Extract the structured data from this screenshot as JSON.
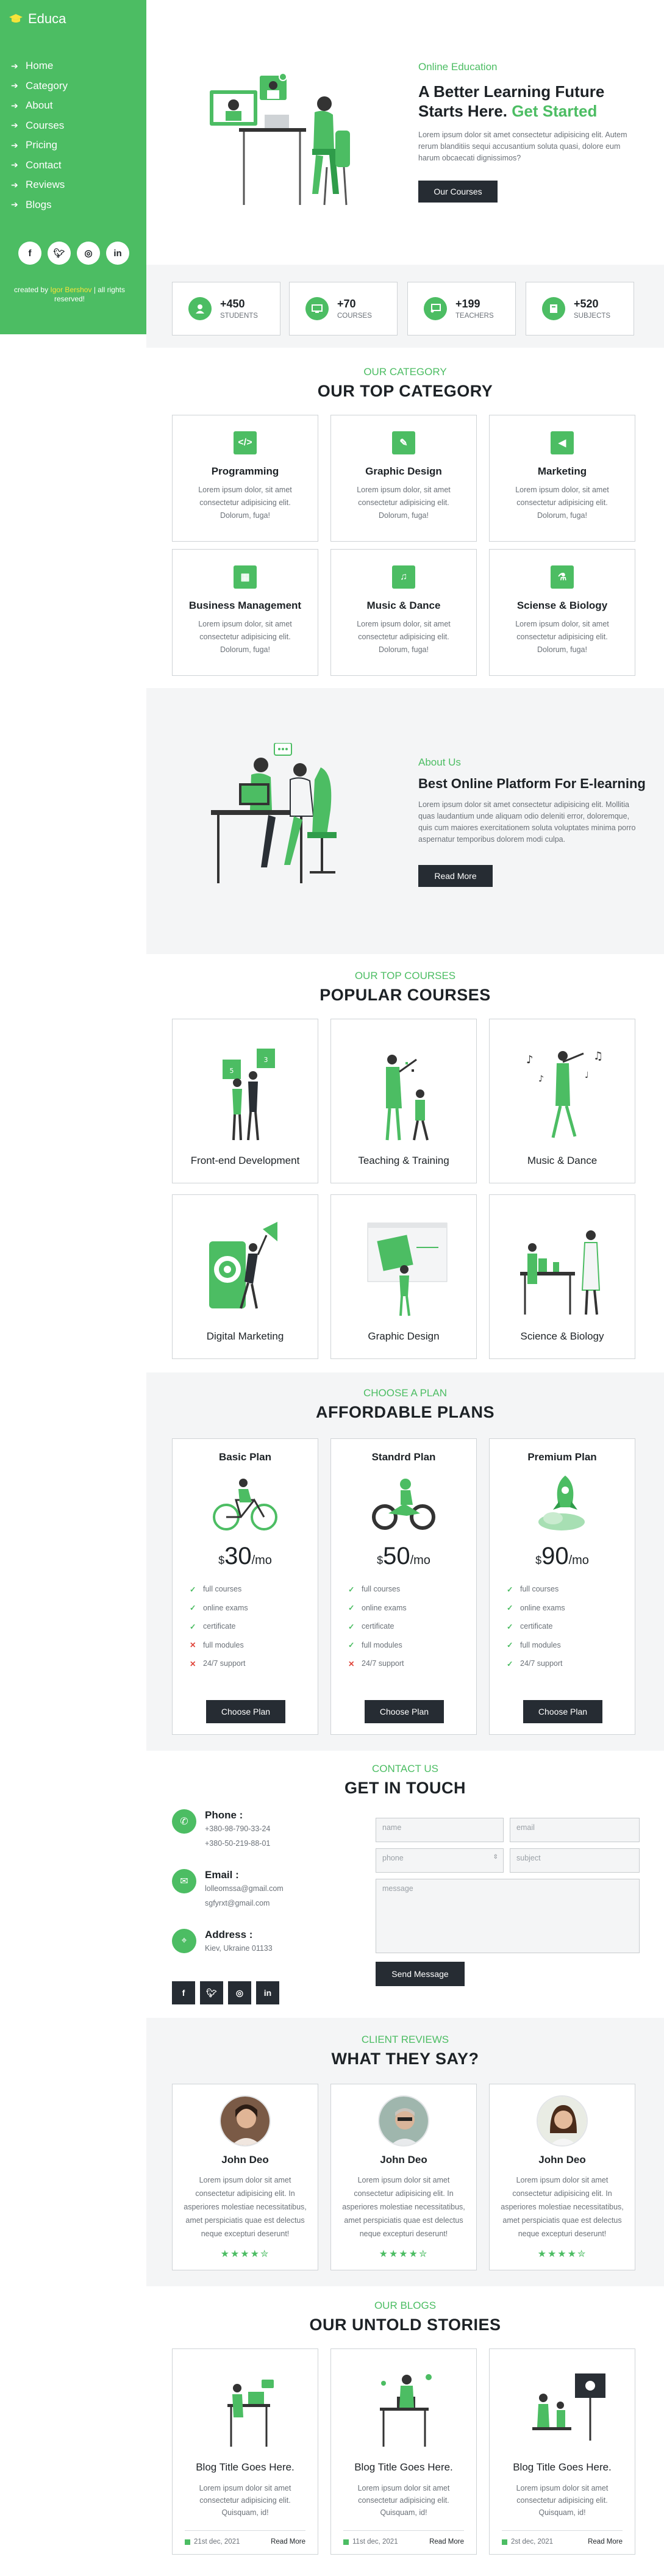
{
  "brand": {
    "name": "Educa",
    "accent": "#4cbd63",
    "dark": "#262c33"
  },
  "nav": [
    {
      "label": "Home"
    },
    {
      "label": "Category"
    },
    {
      "label": "About"
    },
    {
      "label": "Courses"
    },
    {
      "label": "Pricing"
    },
    {
      "label": "Contact"
    },
    {
      "label": "Reviews"
    },
    {
      "label": "Blogs"
    }
  ],
  "sidebar_socials": [
    "facebook-icon",
    "twitter-icon",
    "instagram-icon",
    "linkedin-icon"
  ],
  "credit": {
    "prefix": "created by",
    "author": "Igor Bershov",
    "suffix": "| all rights reserved!"
  },
  "hero": {
    "kicker": "Online Education",
    "title_a": "A Better Learning Future Starts Here.",
    "title_b": "Get Started",
    "text": "Lorem ipsum dolor sit amet consectetur adipisicing elit. Autem rerum blanditiis sequi accusantium soluta quasi, dolore eum harum obcaecati dignissimos?",
    "button": "Our Courses"
  },
  "stats": [
    {
      "num": "+450",
      "label": "STUDENTS",
      "icon": "graduate-icon"
    },
    {
      "num": "+70",
      "label": "COURSES",
      "icon": "monitor-icon"
    },
    {
      "num": "+199",
      "label": "TEACHERS",
      "icon": "chalkboard-icon"
    },
    {
      "num": "+520",
      "label": "SUBJECTS",
      "icon": "book-icon"
    }
  ],
  "category": {
    "kicker": "OUR CATEGORY",
    "title": "OUR TOP CATEGORY",
    "items": [
      {
        "title": "Programming",
        "icon": "code-icon",
        "glyph": "</>",
        "text": "Lorem ipsum dolor, sit amet consectetur adipisicing elit. Dolorum, fuga!"
      },
      {
        "title": "Graphic Design",
        "icon": "brush-icon",
        "glyph": "✎",
        "text": "Lorem ipsum dolor, sit amet consectetur adipisicing elit. Dolorum, fuga!"
      },
      {
        "title": "Marketing",
        "icon": "bullhorn-icon",
        "glyph": "◀",
        "text": "Lorem ipsum dolor, sit amet consectetur adipisicing elit. Dolorum, fuga!"
      },
      {
        "title": "Business Management",
        "icon": "chart-icon",
        "glyph": "▦",
        "text": "Lorem ipsum dolor, sit amet consectetur adipisicing elit. Dolorum, fuga!"
      },
      {
        "title": "Music & Dance",
        "icon": "music-icon",
        "glyph": "♫",
        "text": "Lorem ipsum dolor, sit amet consectetur adipisicing elit. Dolorum, fuga!"
      },
      {
        "title": "Sciense & Biology",
        "icon": "flask-icon",
        "glyph": "⚗",
        "text": "Lorem ipsum dolor, sit amet consectetur adipisicing elit. Dolorum, fuga!"
      }
    ]
  },
  "about": {
    "kicker": "About Us",
    "title": "Best Online Platform For E-learning",
    "text": "Lorem ipsum dolor sit amet consectetur adipisicing elit. Mollitia quas laudantium unde aliquam odio deleniti error, doloremque, quis cum maiores exercitationem soluta voluptates minima porro aspernatur temporibus dolorem modi culpa.",
    "button": "Read More"
  },
  "courses": {
    "kicker": "OUR TOP COURSES",
    "title": "POPULAR COURSES",
    "items": [
      {
        "title": "Front-end Development"
      },
      {
        "title": "Teaching & Training"
      },
      {
        "title": "Music & Dance"
      },
      {
        "title": "Digital Marketing"
      },
      {
        "title": "Graphic Design"
      },
      {
        "title": "Science & Biology"
      }
    ]
  },
  "plans": {
    "kicker": "CHOOSE A PLAN",
    "title": "AFFORDABLE PLANS",
    "currency": "$",
    "period": "/mo",
    "button": "Choose Plan",
    "items": [
      {
        "title": "Basic Plan",
        "price": "30",
        "illustration": "bicycle-icon",
        "features": [
          {
            "t": "full courses",
            "ok": true
          },
          {
            "t": "online exams",
            "ok": true
          },
          {
            "t": "certificate",
            "ok": true
          },
          {
            "t": "full modules",
            "ok": false
          },
          {
            "t": "24/7 support",
            "ok": false
          }
        ]
      },
      {
        "title": "Standrd Plan",
        "price": "50",
        "illustration": "motorbike-icon",
        "features": [
          {
            "t": "full courses",
            "ok": true
          },
          {
            "t": "online exams",
            "ok": true
          },
          {
            "t": "certificate",
            "ok": true
          },
          {
            "t": "full modules",
            "ok": true
          },
          {
            "t": "24/7 support",
            "ok": false
          }
        ]
      },
      {
        "title": "Premium Plan",
        "price": "90",
        "illustration": "rocket-icon",
        "features": [
          {
            "t": "full courses",
            "ok": true
          },
          {
            "t": "online exams",
            "ok": true
          },
          {
            "t": "certificate",
            "ok": true
          },
          {
            "t": "full modules",
            "ok": true
          },
          {
            "t": "24/7 support",
            "ok": true
          }
        ]
      }
    ]
  },
  "contact": {
    "kicker": "CONTACT US",
    "title": "GET IN TOUCH",
    "phone_label": "Phone :",
    "phones": [
      "+380-98-790-33-24",
      "+380-50-219-88-01"
    ],
    "email_label": "Email :",
    "emails": [
      "lolleomssa@gmail.com",
      "sgfyrxt@gmail.com"
    ],
    "address_label": "Address :",
    "address": "Kiev, Ukraine 01133",
    "socials": [
      "facebook-icon",
      "twitter-icon",
      "instagram-icon",
      "linkedin-icon"
    ],
    "form": {
      "name": "name",
      "email": "email",
      "phone": "phone",
      "subject": "subject",
      "message": "message",
      "button": "Send Message"
    }
  },
  "reviews": {
    "kicker": "CLIENT REVIEWS",
    "title": "WHAT THEY SAY?",
    "stars": "★★★★✮",
    "items": [
      {
        "name": "John Deo",
        "text": "Lorem ipsum dolor sit amet consectetur adipisicing elit. In asperiores molestiae necessitatibus, amet perspiciatis quae est delectus neque excepturi deserunt!"
      },
      {
        "name": "John Deo",
        "text": "Lorem ipsum dolor sit amet consectetur adipisicing elit. In asperiores molestiae necessitatibus, amet perspiciatis quae est delectus neque excepturi deserunt!"
      },
      {
        "name": "John Deo",
        "text": "Lorem ipsum dolor sit amet consectetur adipisicing elit. In asperiores molestiae necessitatibus, amet perspiciatis quae est delectus neque excepturi deserunt!"
      }
    ]
  },
  "blogs": {
    "kicker": "OUR BLOGS",
    "title": "OUR UNTOLD STORIES",
    "read_more": "Read More",
    "items": [
      {
        "title": "Blog Title Goes Here.",
        "text": "Lorem ipsum dolor sit amet consectetur adipisicing elit. Quisquam, id!",
        "date": "21st dec, 2021"
      },
      {
        "title": "Blog Title Goes Here.",
        "text": "Lorem ipsum dolor sit amet consectetur adipisicing elit. Quisquam, id!",
        "date": "11st dec, 2021"
      },
      {
        "title": "Blog Title Goes Here.",
        "text": "Lorem ipsum dolor sit amet consectetur adipisicing elit. Quisquam, id!",
        "date": "2st dec, 2021"
      }
    ]
  }
}
